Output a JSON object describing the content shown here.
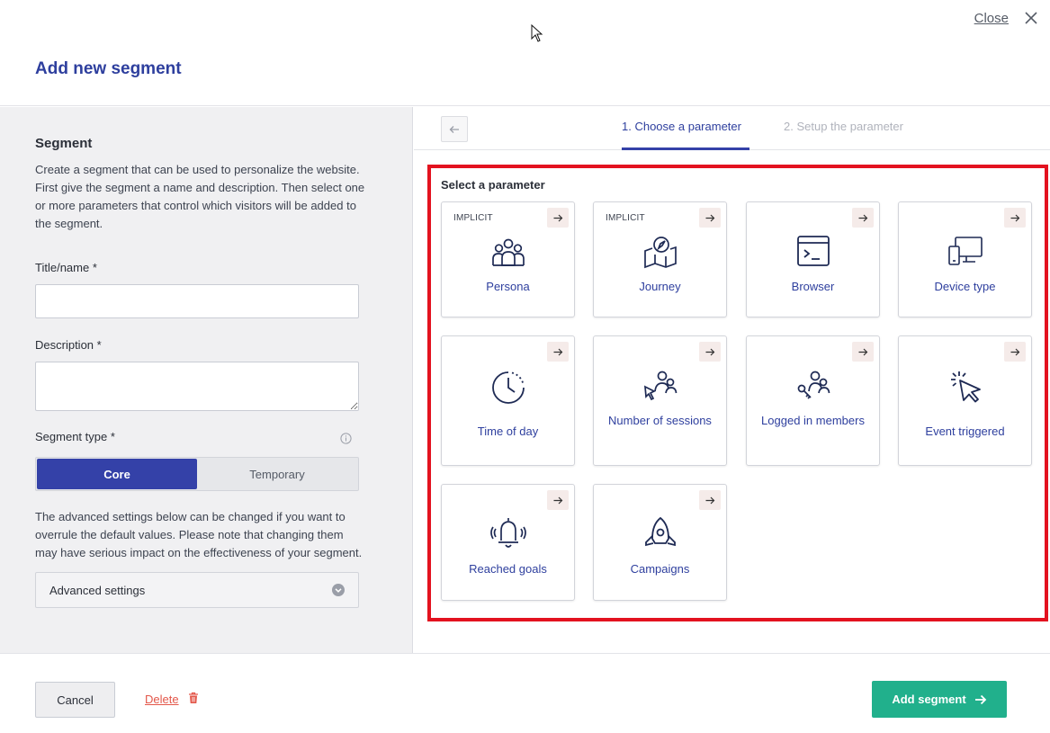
{
  "header": {
    "title": "Add new segment",
    "close_label": "Close"
  },
  "left": {
    "heading": "Segment",
    "description": "Create a segment that can be used to personalize the website. First give the segment a name and description. Then select one or more parameters that control which visitors will be added to the segment.",
    "title_label": "Title/name *",
    "title_value": "",
    "description_label": "Description *",
    "description_value": "",
    "type_label": "Segment type *",
    "type_options": [
      "Core",
      "Temporary"
    ],
    "type_selected": "Core",
    "advanced_note": "The advanced settings below can be changed if you want to overrule the default values. Please note that changing them may have serious impact on the effectiveness of your segment.",
    "advanced_label": "Advanced settings"
  },
  "steps": {
    "step1": "1. Choose a parameter",
    "step2": "2. Setup the parameter"
  },
  "parameters": {
    "label": "Select a parameter",
    "items": [
      {
        "name": "Persona",
        "tag": "IMPLICIT",
        "icon": "persona-icon"
      },
      {
        "name": "Journey",
        "tag": "IMPLICIT",
        "icon": "journey-icon"
      },
      {
        "name": "Browser",
        "tag": "",
        "icon": "browser-icon"
      },
      {
        "name": "Device type",
        "tag": "",
        "icon": "device-type-icon"
      },
      {
        "name": "Time of day",
        "tag": "",
        "icon": "time-of-day-icon"
      },
      {
        "name": "Number of sessions",
        "tag": "",
        "icon": "number-of-sessions-icon"
      },
      {
        "name": "Logged in members",
        "tag": "",
        "icon": "logged-in-members-icon"
      },
      {
        "name": "Event triggered",
        "tag": "",
        "icon": "event-triggered-icon"
      },
      {
        "name": "Reached goals",
        "tag": "",
        "icon": "reached-goals-icon"
      },
      {
        "name": "Campaigns",
        "tag": "",
        "icon": "campaigns-icon"
      }
    ]
  },
  "footer": {
    "cancel_label": "Cancel",
    "delete_label": "Delete",
    "add_label": "Add segment"
  },
  "colors": {
    "primary": "#3441a8",
    "link": "#2e3f9e",
    "success": "#21b08c",
    "danger": "#e3574a",
    "highlight": "#e3121f"
  }
}
